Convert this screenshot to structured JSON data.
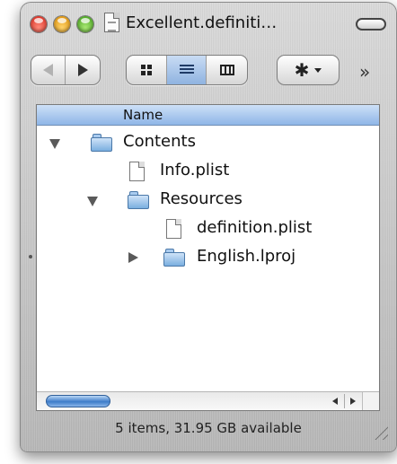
{
  "window": {
    "title": "Excellent.definiti…",
    "status": "5 items, 31.95 GB available"
  },
  "toolbar": {
    "back_icon": "back-arrow-icon",
    "forward_icon": "forward-arrow-icon",
    "view_modes": [
      "icon-view-icon",
      "list-view-icon",
      "column-view-icon"
    ],
    "active_view": "list",
    "action_icon": "gear-icon",
    "overflow_label": "»"
  },
  "list": {
    "column_header": "Name",
    "items": [
      {
        "name": "Contents",
        "kind": "folder",
        "level": 0,
        "disclosure": "expanded"
      },
      {
        "name": "Info.plist",
        "kind": "file",
        "level": 1,
        "disclosure": "none"
      },
      {
        "name": "Resources",
        "kind": "folder",
        "level": 1,
        "disclosure": "expanded"
      },
      {
        "name": "definition.plist",
        "kind": "file",
        "level": 2,
        "disclosure": "none"
      },
      {
        "name": "English.lproj",
        "kind": "folder",
        "level": 2,
        "disclosure": "collapsed"
      }
    ]
  },
  "colors": {
    "header_blue": "#8fb6e7",
    "folder_blue": "#7aaedf",
    "close_red": "#d42318",
    "minimize_yellow": "#d98a00",
    "zoom_green": "#3b9a16"
  }
}
